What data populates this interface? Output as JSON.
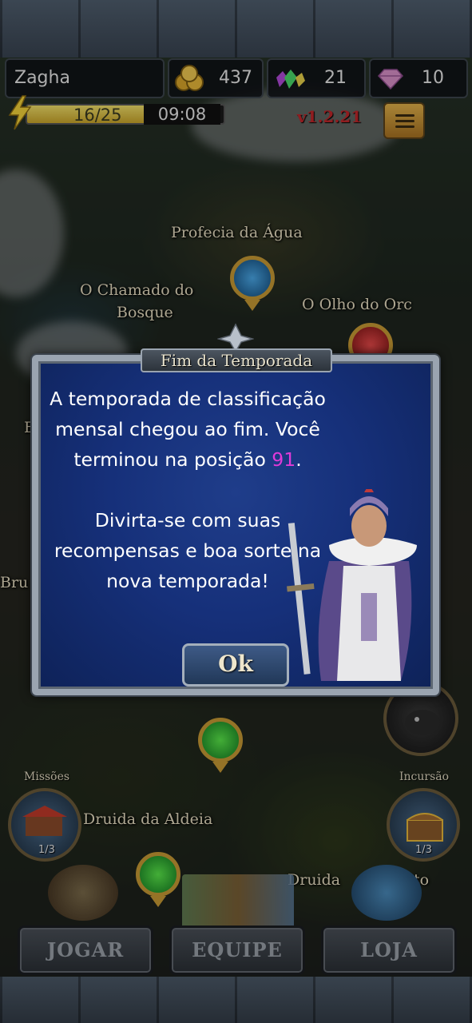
{
  "hud": {
    "player_name": "Zagha",
    "gold": "437",
    "gems": "21",
    "diamonds": "10",
    "energy_text": "16/25",
    "energy_fraction": 0.64,
    "timer": "09:08",
    "version": "v1.2.21"
  },
  "map": {
    "places": [
      "Profecia da Água",
      "O Chamado do",
      "Bosque",
      "O Olho do Orc",
      "Bru",
      "Druida da Aldeia",
      "Druida",
      "to",
      "E"
    ]
  },
  "dialog": {
    "title": "Fim da Temporada",
    "line1": "A temporada de classificação mensal chegou ao fim. Você terminou na posição ",
    "rank": "91",
    "line1_end": ".",
    "line2": "Divirta-se com suas recompensas e boa sorte na nova temporada!",
    "ok_label": "Ok"
  },
  "side": {
    "missions_label": "Missões",
    "missions_count": "1/3",
    "raid_label": "Incursão",
    "raid_count": "1/3"
  },
  "nav": {
    "play": "JOGAR",
    "team": "EQUIPE",
    "shop": "LOJA"
  },
  "colors": {
    "rank_highlight": "#e03ad8",
    "dialog_bg": "#16307a",
    "version_red": "#c0262a"
  }
}
